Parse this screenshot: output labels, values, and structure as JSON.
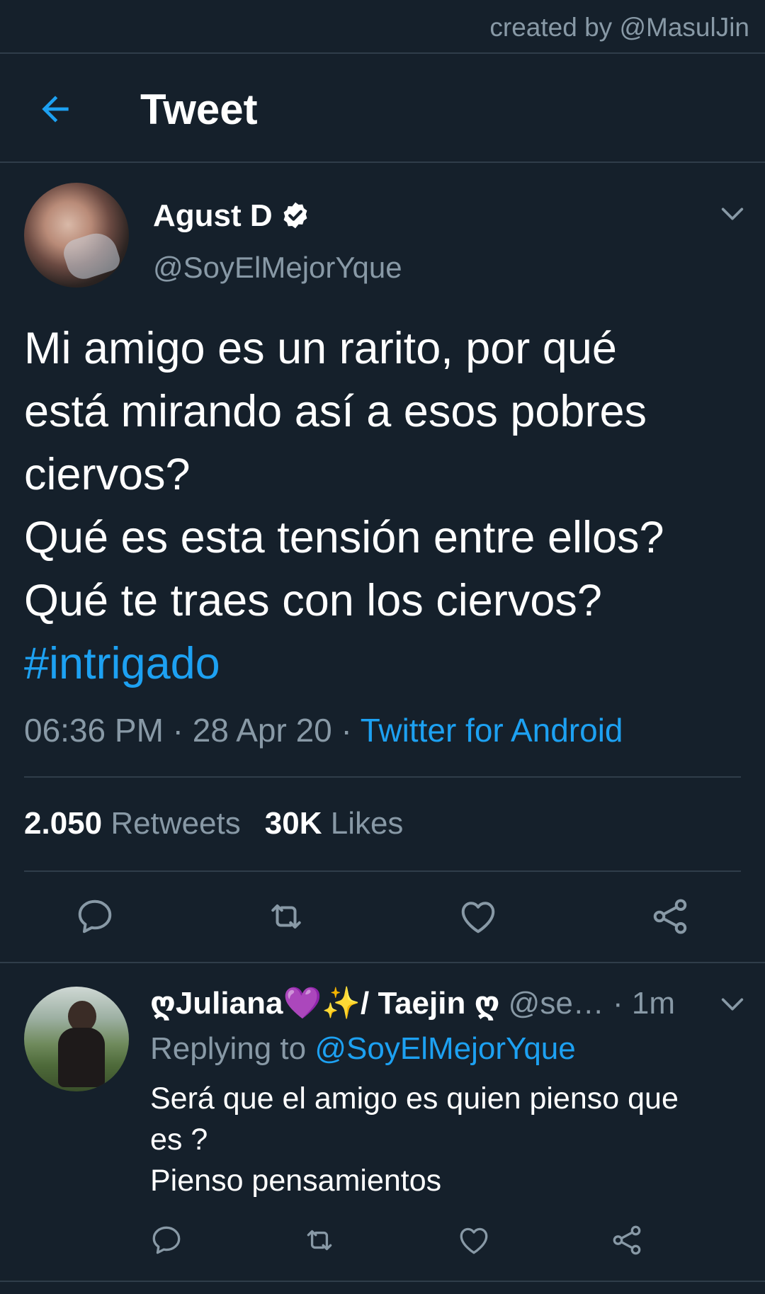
{
  "credit": "created by @MasulJin",
  "header": {
    "title": "Tweet"
  },
  "tweet": {
    "author_name": "Agust D",
    "author_handle": "@SoyElMejorYque",
    "text_lines": [
      "Mi amigo es un rarito, por qué",
      "está mirando así a esos pobres",
      "ciervos?",
      "Qué es esta tensión entre ellos?",
      "Qué te traes con los ciervos?"
    ],
    "hashtag": "#intrigado",
    "time": "06:36 PM",
    "date": "28 Apr 20",
    "meta_sep": " · ",
    "source": "Twitter for Android",
    "retweets_count": "2.050",
    "retweets_label": "Retweets",
    "likes_count": "30K",
    "likes_label": "Likes"
  },
  "reply": {
    "name": "ღJuliana💜✨/ Taejin ღ",
    "handle": "@se…",
    "time": "· 1m",
    "replying_prefix": "Replying to",
    "replying_mention": "@SoyElMejorYque",
    "text_lines": [
      "Será que el amigo es quien pienso que",
      "es ?",
      "Pienso pensamientos"
    ]
  },
  "icons": {
    "back": "arrow-left-icon",
    "verified": "verified-badge-icon",
    "more": "chevron-down-icon",
    "reply": "comment-icon",
    "retweet": "retweet-icon",
    "like": "heart-icon",
    "share": "share-icon"
  },
  "colors": {
    "background": "#15202b",
    "accent": "#1da1f2",
    "secondary_text": "#8899a6",
    "divider": "#2f3d4a"
  }
}
